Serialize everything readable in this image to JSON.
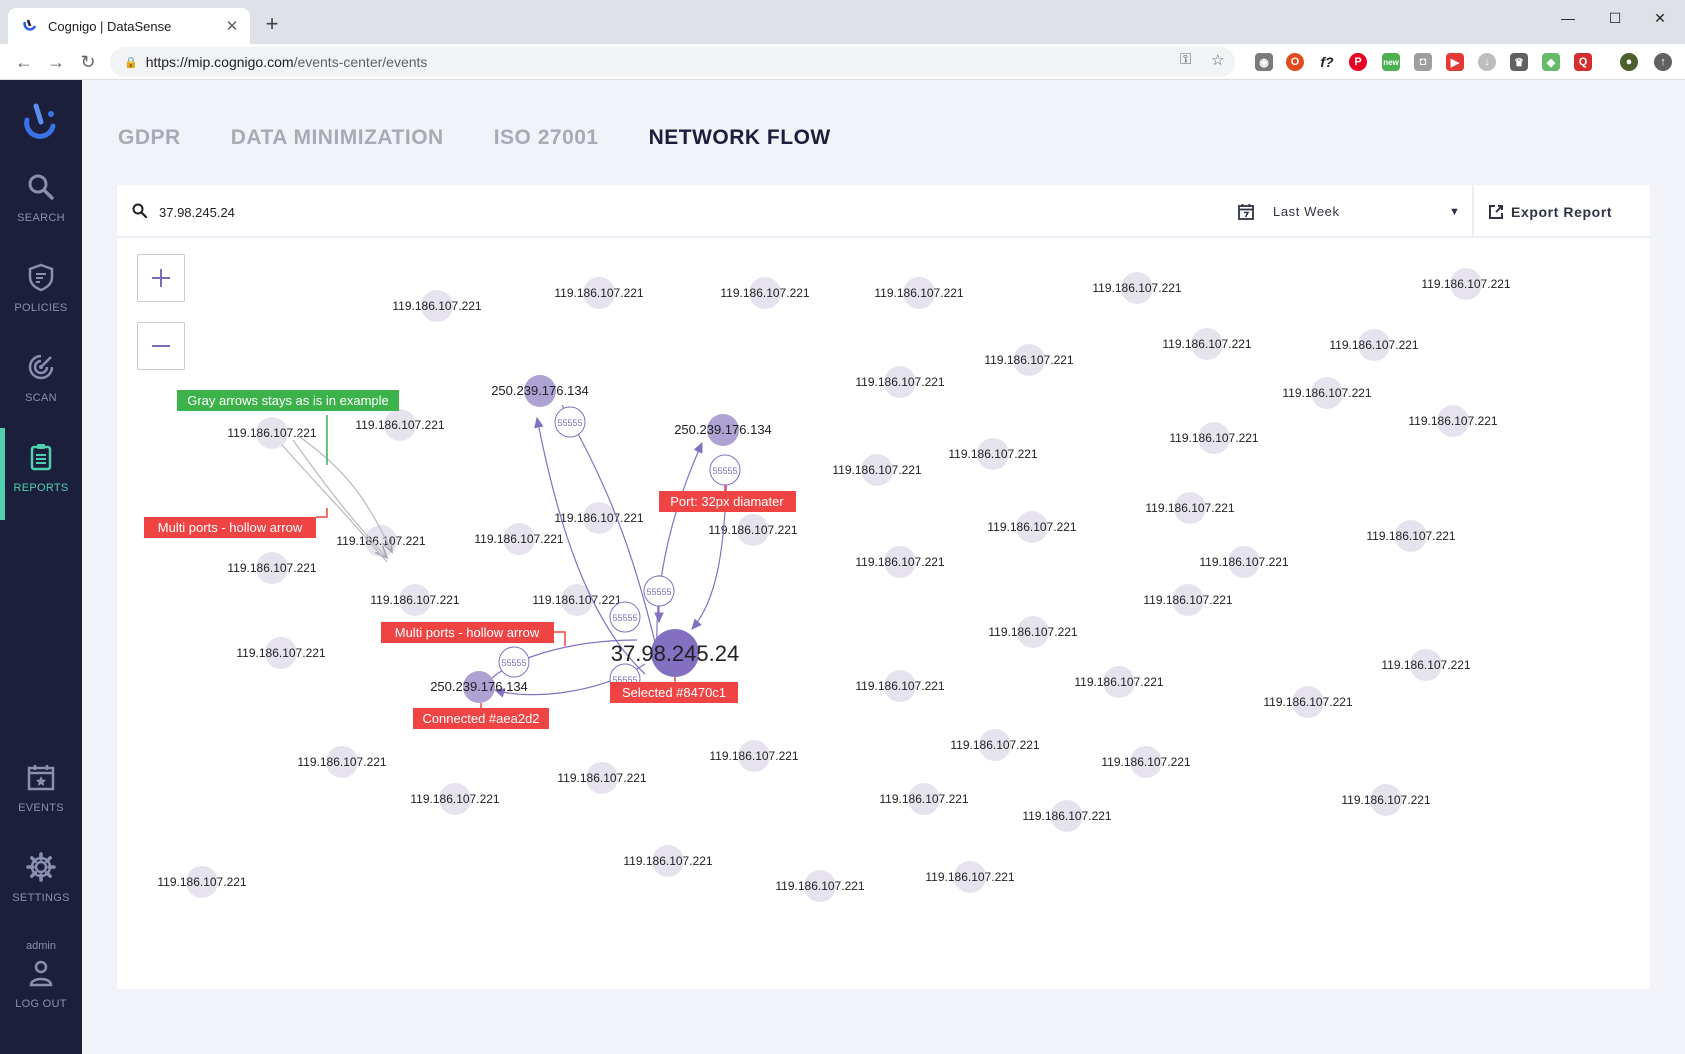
{
  "browser": {
    "tab_title": "Cognigo | DataSense",
    "tab_close": "✕",
    "new_tab": "+",
    "url_host": "https://mip.cognigo.com",
    "url_path": "/events-center/events",
    "ext_new_badge": "new"
  },
  "sidebar": {
    "items": [
      {
        "label": "SEARCH",
        "icon": "search-icon"
      },
      {
        "label": "POLICIES",
        "icon": "shield-icon"
      },
      {
        "label": "SCAN",
        "icon": "radar-icon"
      },
      {
        "label": "REPORTS",
        "icon": "clipboard-icon",
        "active": true
      },
      {
        "label": "EVENTS",
        "icon": "calendar-icon"
      },
      {
        "label": "SETTINGS",
        "icon": "gear-icon"
      }
    ],
    "user": "admin",
    "logout": "LOG OUT"
  },
  "tabs": [
    "GDPR",
    "DATA MINIMIZATION",
    "ISO 27001",
    "NETWORK FLOW"
  ],
  "active_tab": "NETWORK FLOW",
  "search": {
    "value": "37.98.245.24"
  },
  "period": {
    "value": "Last Week"
  },
  "export": {
    "label": "Export Report"
  },
  "zoom": {
    "in": "+",
    "out": "−"
  },
  "graph": {
    "colors": {
      "selected": "#8470c1",
      "connected": "#aea2d2",
      "inactive": "#e6e3ef",
      "edge": "#8470c1",
      "gray_edge": "#b8b8c0",
      "annotation_red": "#f04444",
      "annotation_green": "#3cb24a"
    },
    "selected": {
      "label": "37.98.245.24"
    },
    "connected": [
      {
        "label": "250.239.176.134"
      },
      {
        "label": "250.239.176.134"
      },
      {
        "label": "250.239.176.134"
      }
    ],
    "ports": [
      "55555",
      "55555",
      "55555",
      "55555",
      "55555",
      "55555"
    ],
    "inactive_label": "119.186.107.221",
    "annotations": [
      {
        "text": "Gray arrows stays as is in example",
        "color": "green"
      },
      {
        "text": "Multi ports - hollow arrow",
        "color": "red"
      },
      {
        "text": "Port: 32px diamater",
        "color": "red"
      },
      {
        "text": "Multi ports - hollow arrow",
        "color": "red"
      },
      {
        "text": "Connected #aea2d2",
        "color": "red"
      },
      {
        "text": "Selected #8470c1",
        "color": "red"
      }
    ]
  }
}
